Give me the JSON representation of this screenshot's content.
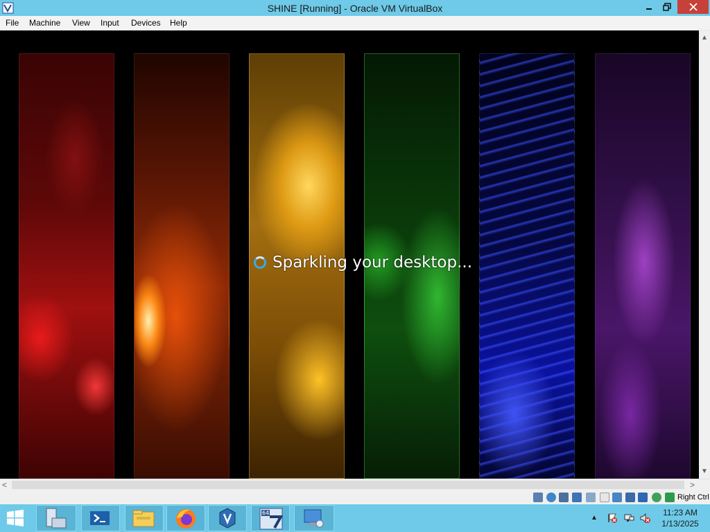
{
  "window": {
    "title": "SHINE [Running] - Oracle VM VirtualBox",
    "icon": "virtualbox-icon"
  },
  "menu": {
    "items": [
      "File",
      "Machine",
      "View",
      "Input",
      "Devices",
      "Help"
    ]
  },
  "vm": {
    "boot_message": "Sparkling your desktop...",
    "panel_colors": [
      "#a01010",
      "#e06010",
      "#e0a020",
      "#20a020",
      "#1020d0",
      "#8030b0"
    ]
  },
  "status_bar": {
    "icons": [
      "hard-disk-icon",
      "optical-disk-icon",
      "audio-icon",
      "network-icon",
      "usb-icon",
      "shared-folders-icon",
      "display-icon",
      "video-capture-icon",
      "mouse-integration-icon",
      "cpu-icon",
      "vt-x-icon",
      "guest-additions-icon",
      "globe-icon",
      "keyboard-icon"
    ],
    "host_key": "Right Ctrl"
  },
  "taskbar": {
    "start_icon": "windows-start-icon",
    "apps": [
      "server-manager-icon",
      "powershell-icon",
      "file-explorer-icon",
      "firefox-icon",
      "virtualbox-icon",
      "windows7-64bit-vm-icon",
      "remote-desktop-icon"
    ],
    "tray_icons": [
      "flag-icon",
      "network-icon",
      "speaker-muted-icon"
    ],
    "time": "11:23 AM",
    "date": "1/13/2025"
  }
}
